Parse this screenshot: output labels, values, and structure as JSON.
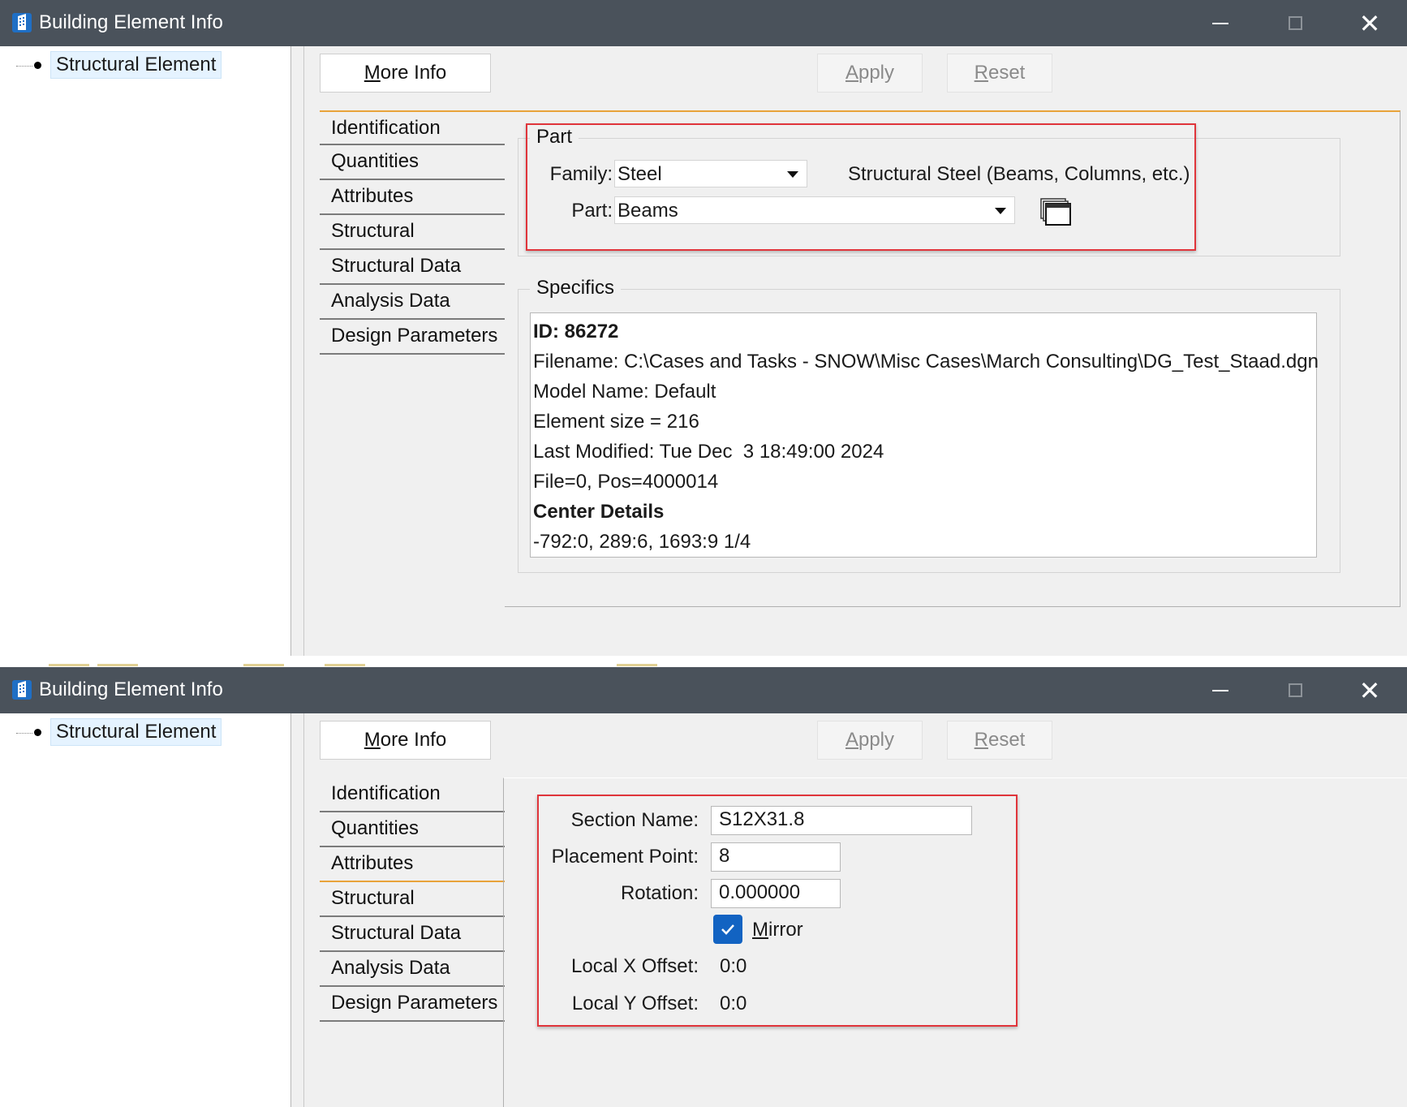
{
  "window1": {
    "title": "Building Element Info",
    "tree_item": "Structural Element",
    "buttons": {
      "more_info_pre": "",
      "more_info_u": "M",
      "more_info_post": "ore Info",
      "apply_pre": "",
      "apply_u": "A",
      "apply_post": "pply",
      "reset_pre": "",
      "reset_u": "R",
      "reset_post": "eset"
    },
    "tabs": [
      "Identification",
      "Quantities",
      "Attributes",
      "Structural",
      "Structural Data",
      "Analysis Data",
      "Design Parameters"
    ],
    "part_group": {
      "title": "Part",
      "family_label": "Family:",
      "family_value": "Steel",
      "family_description": "Structural Steel (Beams, Columns, etc.)",
      "part_label": "Part:",
      "part_value": "Beams"
    },
    "specifics": {
      "title": "Specifics",
      "lines": [
        "ID: 86272",
        "Filename: C:\\Cases and Tasks - SNOW\\Misc Cases\\March Consulting\\DG_Test_Staad.dgn",
        "Model Name: Default",
        "Element size = 216",
        "Last Modified: Tue Dec  3 18:49:00 2024",
        "File=0, Pos=4000014",
        "Center Details",
        "-792:0, 289:6, 1693:9 1/4"
      ]
    }
  },
  "window2": {
    "title": "Building Element Info",
    "tree_item": "Structural Element",
    "buttons": {
      "more_info_pre": "",
      "more_info_u": "M",
      "more_info_post": "ore Info",
      "apply_pre": "",
      "apply_u": "A",
      "apply_post": "pply",
      "reset_pre": "",
      "reset_u": "R",
      "reset_post": "eset"
    },
    "tabs": [
      "Identification",
      "Quantities",
      "Attributes",
      "Structural",
      "Structural Data",
      "Analysis Data",
      "Design Parameters"
    ],
    "structural": {
      "section_name_label": "Section Name:",
      "section_name_value": "S12X31.8",
      "placement_point_label": "Placement Point:",
      "placement_point_value": "8",
      "rotation_label": "Rotation:",
      "rotation_value": "0.000000",
      "mirror_pre": "",
      "mirror_u": "M",
      "mirror_post": "irror",
      "mirror_checked": true,
      "local_x_label": "Local X Offset:",
      "local_x_value": "0:0",
      "local_y_label": "Local Y Offset:",
      "local_y_value": "0:0"
    }
  },
  "colors": {
    "titlebar": "#4a525b",
    "highlight": "#e0353b",
    "tab_accent": "#e8a33a",
    "checkbox": "#1263c2"
  },
  "icons": [
    "building-app-icon",
    "minimize-icon",
    "maximize-icon",
    "close-icon",
    "dropdown-caret-icon",
    "catalog-browse-icon",
    "checkmark-icon"
  ]
}
